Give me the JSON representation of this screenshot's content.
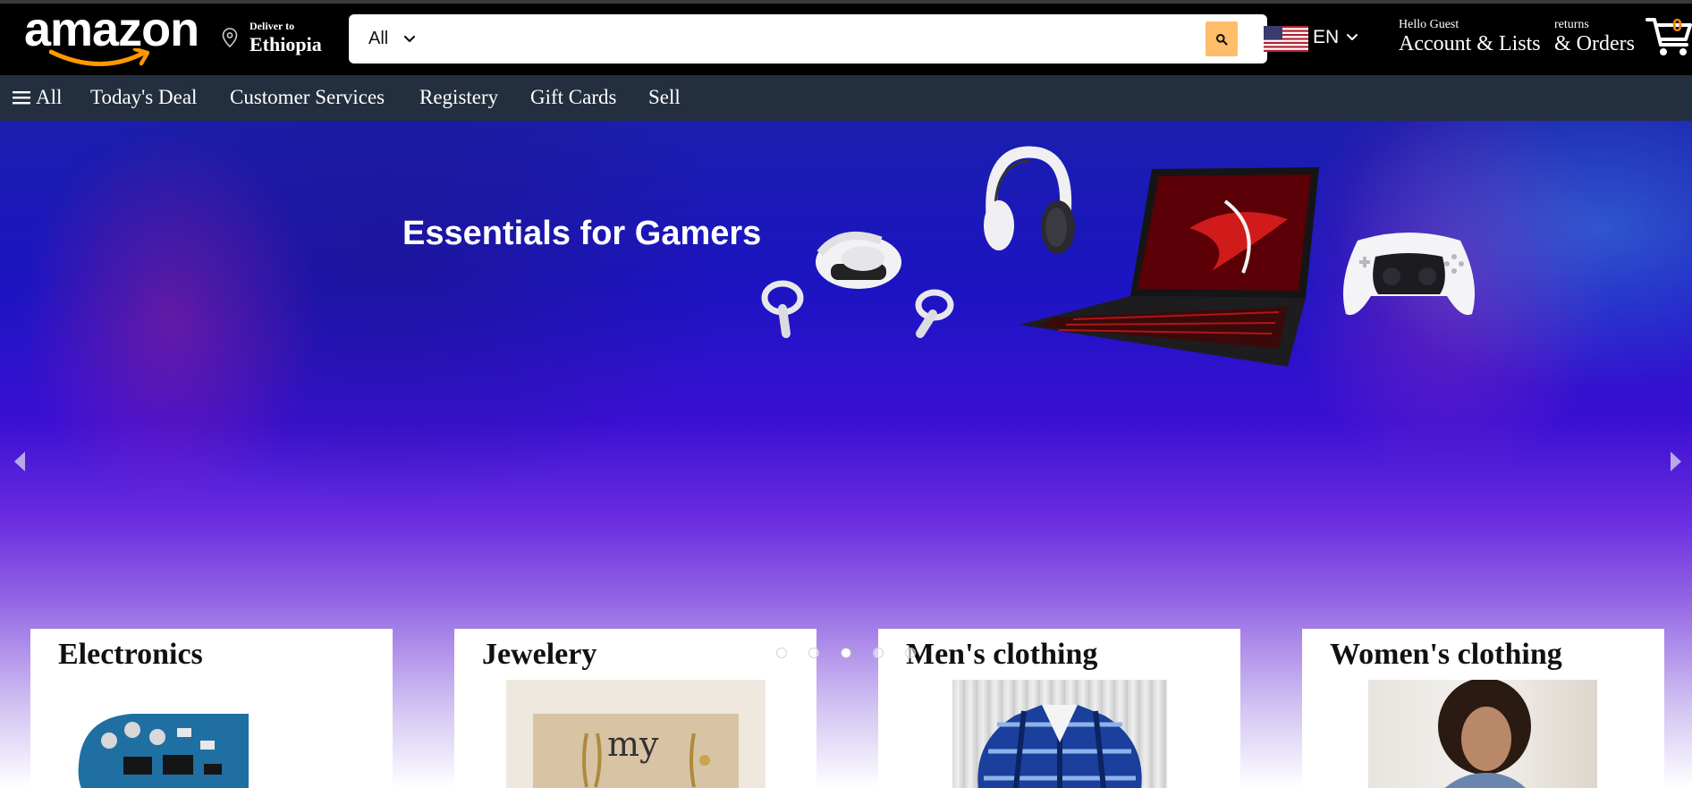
{
  "header": {
    "logo_text": "amazon",
    "deliver_small": "Deliver to",
    "deliver_big": "Ethiopia",
    "search_category": "All",
    "search_placeholder": "",
    "language_code": "EN",
    "account_small": "Hello Guest",
    "account_big": "Account & Lists",
    "orders_small": "returns",
    "orders_big": "& Orders",
    "cart_count": "0"
  },
  "nav": {
    "all_label": "All",
    "items": [
      "Today's Deal",
      "Customer Services",
      "Registery",
      "Gift Cards",
      "Sell"
    ]
  },
  "hero": {
    "title": "Essentials for Gamers",
    "slide_count": 5,
    "active_slide": 3
  },
  "categories": [
    {
      "title": "Electronics"
    },
    {
      "title": "Jewelery"
    },
    {
      "title": "Men's clothing"
    },
    {
      "title": "Women's clothing"
    }
  ],
  "jewelry_card_text": "my",
  "colors": {
    "header_bg": "#000000",
    "nav_bg": "#232f3e",
    "search_button": "#febd69",
    "logo_smile": "#f90",
    "cart_count": "#f08804"
  },
  "icons": {
    "location": "map-pin-icon",
    "search": "magnifier-icon",
    "menu": "hamburger-icon",
    "cart": "shopping-cart-icon"
  }
}
